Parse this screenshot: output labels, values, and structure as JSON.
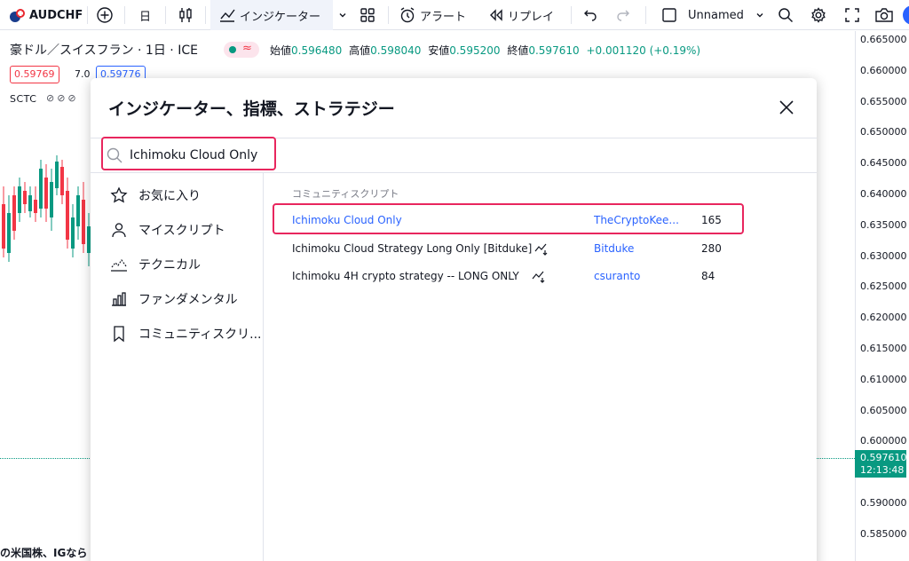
{
  "toolbar": {
    "symbol": "AUDCHF",
    "interval": "日",
    "indicators_label": "インジケーター",
    "alert_label": "アラート",
    "replay_label": "リプレイ",
    "layout_name": "Unnamed"
  },
  "legend": {
    "title": "豪ドル／スイスフラン · 1日 · ICE",
    "wave": "≈",
    "open_label": "始値",
    "open": "0.596480",
    "high_label": "高値",
    "high": "0.598040",
    "low_label": "安値",
    "low": "0.595200",
    "close_label": "終値",
    "close": "0.597610",
    "change": "+0.001120 (+0.19%)",
    "sell_price": "0.59769",
    "spread": "7.0",
    "buy_price": "0.59776",
    "study": "SCTC",
    "study_icons": "⊘⊘⊘"
  },
  "price_axis": {
    "ticks": [
      "0.665000",
      "0.660000",
      "0.655000",
      "0.650000",
      "0.645000",
      "0.640000",
      "0.635000",
      "0.630000",
      "0.625000",
      "0.620000",
      "0.615000",
      "0.610000",
      "0.605000",
      "0.600000",
      "0.590000",
      "0.585000"
    ],
    "current_price": "0.597610",
    "countdown": "12:13:48"
  },
  "news_snippet": "の米国株、IGなら",
  "dialog": {
    "title": "インジケーター、指標、ストラテジー",
    "search_value": "Ichimoku Cloud Only",
    "sidebar": [
      {
        "label": "お気に入り",
        "icon": "star-icon"
      },
      {
        "label": "マイスクリプト",
        "icon": "user-icon"
      },
      {
        "label": "テクニカル",
        "icon": "technicals-icon"
      },
      {
        "label": "ファンダメンタル",
        "icon": "fundamentals-icon"
      },
      {
        "label": "コミュニティスクリ...",
        "icon": "bookmark-icon"
      }
    ],
    "section_label": "コミュニティスクリプト",
    "results": [
      {
        "name": "Ichimoku Cloud Only",
        "author": "TheCryptoKee...",
        "count": "165",
        "strategy": false
      },
      {
        "name": "Ichimoku Cloud Strategy Long Only [Bitduke]",
        "author": "Bitduke",
        "count": "280",
        "strategy": true
      },
      {
        "name": "Ichimoku 4H crypto strategy -- LONG ONLY",
        "author": "csuranto",
        "count": "84",
        "strategy": true
      }
    ]
  },
  "colors": {
    "up": "#089981",
    "down": "#f23645",
    "link": "#2962ff",
    "annotation": "#e8265e"
  }
}
